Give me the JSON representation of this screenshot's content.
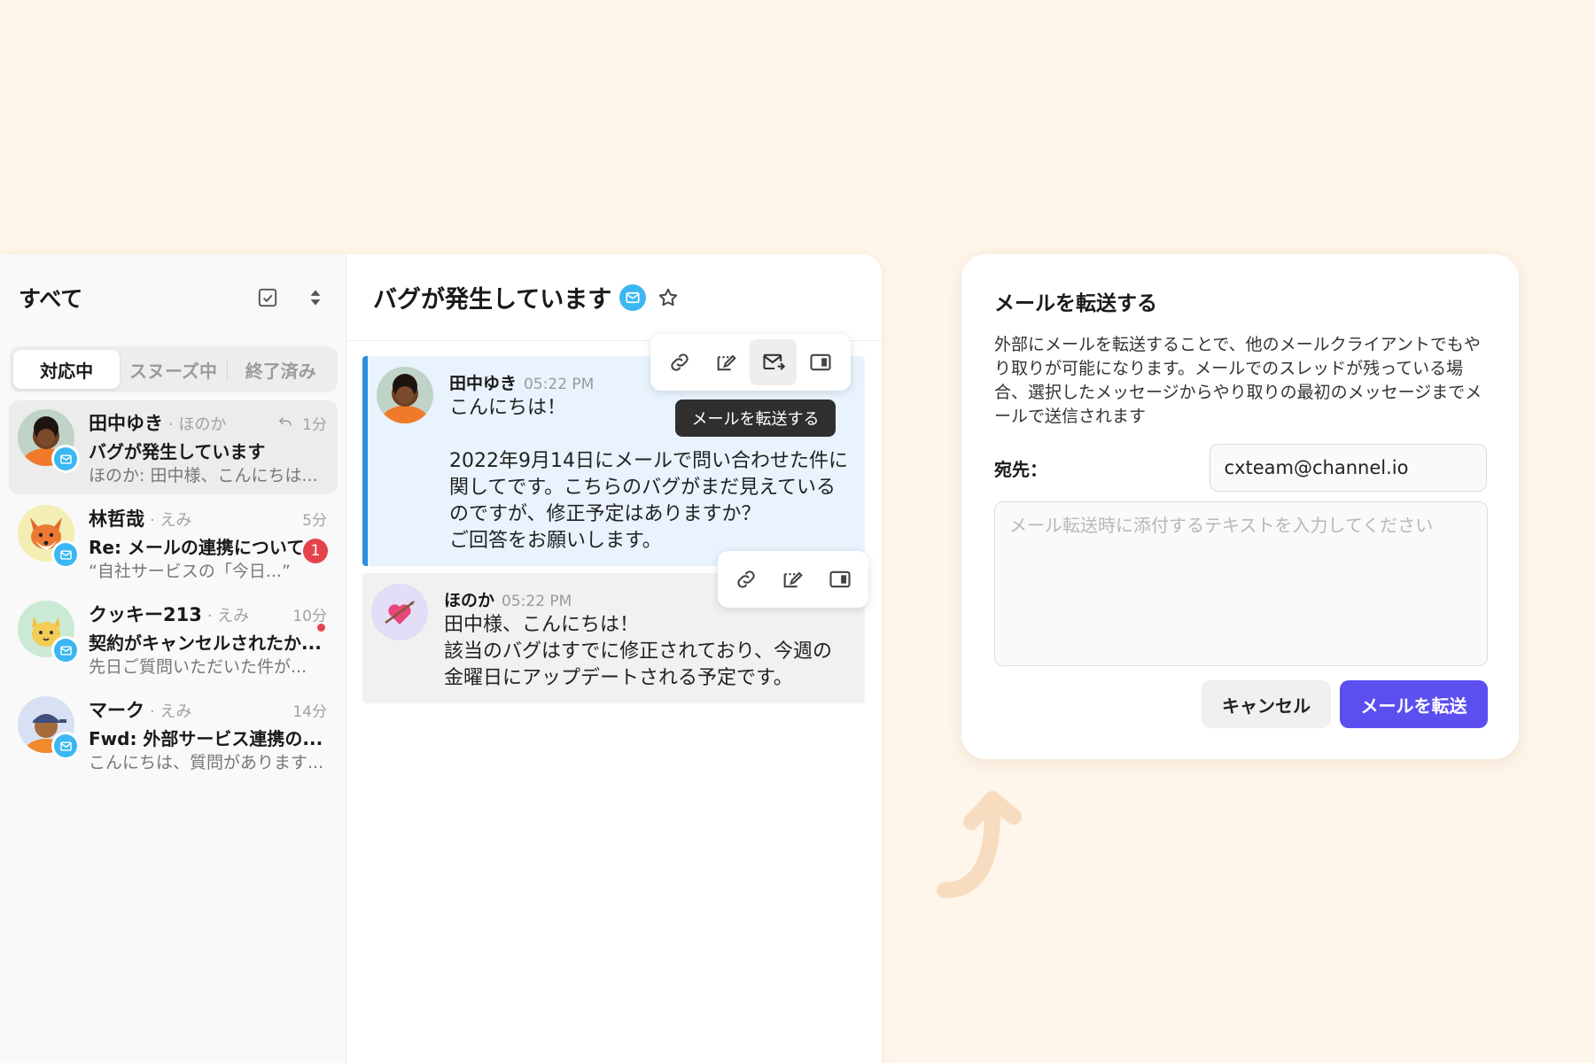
{
  "sidebar": {
    "title": "すべて",
    "tabs": [
      {
        "label": "対応中",
        "active": true
      },
      {
        "label": "スヌーズ中",
        "active": false
      },
      {
        "label": "終了済み",
        "active": false
      }
    ],
    "conversations": [
      {
        "name": "田中ゆき",
        "sub": "· ほのか",
        "time": "1分",
        "subject": "バグが発生しています",
        "preview": "ほのか: 田中様、こんにちは...",
        "avatar": "person-orange-jacket",
        "replied": true,
        "selected": true
      },
      {
        "name": "林哲哉",
        "sub": "· えみ",
        "time": "5分",
        "subject": "Re: メールの連携について",
        "preview": "“自社サービスの「今日...”",
        "avatar": "fox",
        "unread_count": "1"
      },
      {
        "name": "クッキー213",
        "sub": "· えみ",
        "time": "10分",
        "subject": "契約がキャンセルされたか...",
        "preview": "先日ご質問いただいた件が...",
        "avatar": "cat",
        "unread_dot": true
      },
      {
        "name": "マーク",
        "sub": "· えみ",
        "time": "14分",
        "subject": "Fwd: 外部サービス連携の...",
        "preview": "こんにちは、質問があります...",
        "avatar": "person-cap"
      }
    ]
  },
  "thread": {
    "title": "バグが発生しています",
    "messages": [
      {
        "author": "田中ゆき",
        "time": "05:22 PM",
        "text": "こんにちは！\n\n2022年9月14日にメールで問い合わせた件に\n関してです。こちらのバグがまだ見えている\nのですが、修正予定はありますか？\nご回答をお願いします。"
      },
      {
        "author": "ほのか",
        "time": "05:22 PM",
        "text": "田中様、こんにちは！\n該当のバグはすでに修正されており、今週の\n金曜日にアップデートされる予定です。"
      }
    ],
    "tooltip": "メールを転送する"
  },
  "dialog": {
    "title": "メールを転送する",
    "description": "外部にメールを転送することで、他のメールクライアントでもやり取りが可能になります。メールでのスレッドが残っている場合、選択したメッセージからやり取りの最初のメッセージまでメールで送信されます",
    "to_label": "宛先：",
    "to_value": "cxteam@channel.io",
    "note_placeholder": "メール転送時に添付するテキストを入力してください",
    "cancel_label": "キャンセル",
    "submit_label": "メールを転送"
  },
  "colors": {
    "background": "#fef6ea",
    "accent": "#5b4ff0",
    "mail_badge": "#3bb7f3",
    "selected_bar": "#2c8fe0",
    "unread": "#e5434b"
  }
}
